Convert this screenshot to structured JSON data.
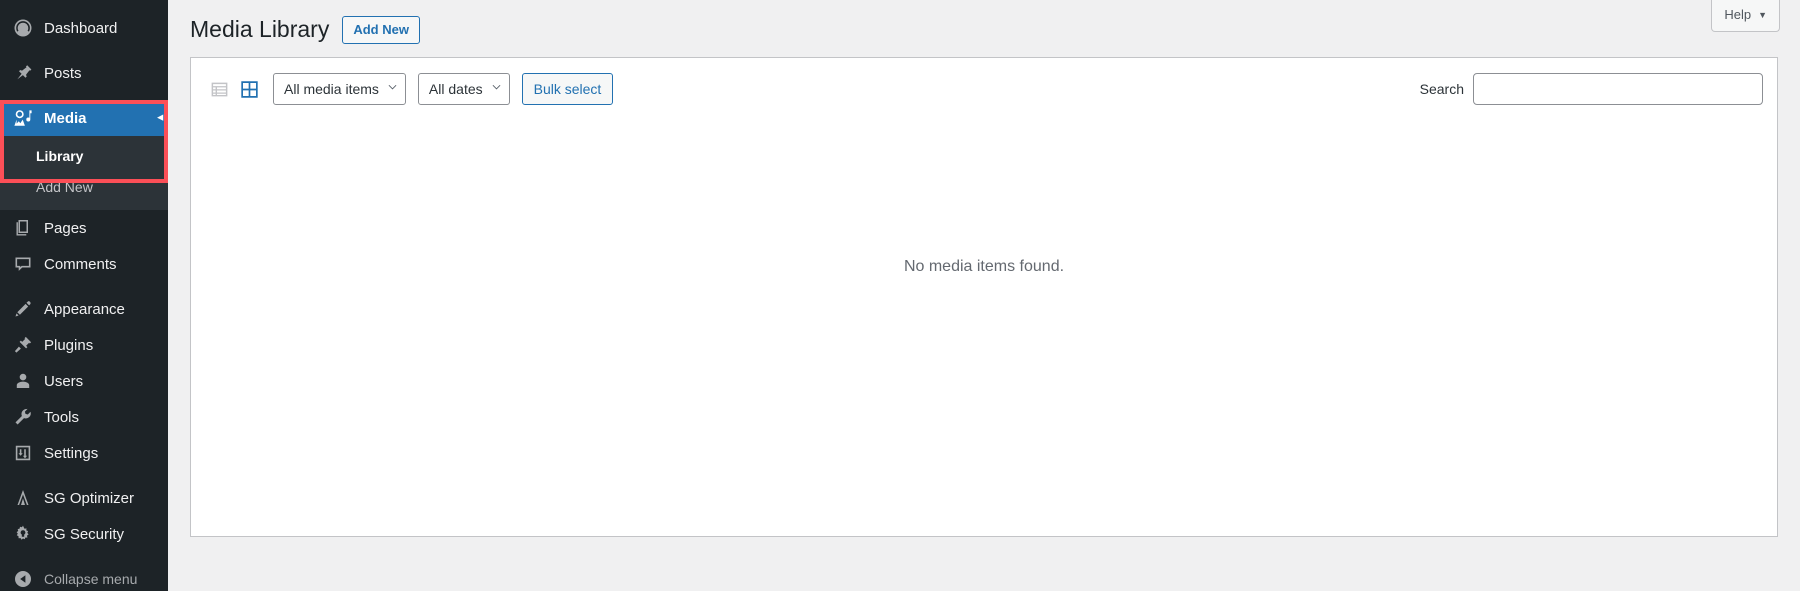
{
  "sidebar": {
    "items": [
      {
        "label": "Dashboard",
        "icon": "dashboard-icon",
        "name": "dashboard"
      },
      {
        "label": "Posts",
        "icon": "pin-icon",
        "name": "posts"
      },
      {
        "label": "Media",
        "icon": "media-icon",
        "name": "media",
        "current": true,
        "arrow": "◂"
      },
      {
        "label": "Pages",
        "icon": "pages-icon",
        "name": "pages"
      },
      {
        "label": "Comments",
        "icon": "comments-icon",
        "name": "comments"
      },
      {
        "label": "Appearance",
        "icon": "brush-icon",
        "name": "appearance"
      },
      {
        "label": "Plugins",
        "icon": "plugin-icon",
        "name": "plugins"
      },
      {
        "label": "Users",
        "icon": "user-icon",
        "name": "users"
      },
      {
        "label": "Tools",
        "icon": "wrench-icon",
        "name": "tools"
      },
      {
        "label": "Settings",
        "icon": "settings-icon",
        "name": "settings"
      },
      {
        "label": "SG Optimizer",
        "icon": "sg-optimizer-icon",
        "name": "sg-optimizer"
      },
      {
        "label": "SG Security",
        "icon": "sg-security-icon",
        "name": "sg-security"
      }
    ],
    "media_submenu": [
      {
        "label": "Library",
        "current": true
      },
      {
        "label": "Add New",
        "current": false
      }
    ],
    "collapse": {
      "label": "Collapse menu",
      "icon": "collapse-left-icon"
    }
  },
  "screen_meta": {
    "help_label": "Help",
    "help_caret": "▼"
  },
  "page": {
    "title": "Media Library",
    "add_new_label": "Add New"
  },
  "toolbar": {
    "view_list_icon": "list-view-icon",
    "view_grid_icon": "grid-view-icon",
    "filter_type": "All media items",
    "filter_date": "All dates",
    "bulk_select_label": "Bulk select",
    "search_label": "Search",
    "search_value": "",
    "search_placeholder": ""
  },
  "content": {
    "empty_message": "No media items found."
  },
  "colors": {
    "sidebar_bg": "#1d2327",
    "submenu_bg": "#2c3338",
    "accent_blue": "#2271b1",
    "annotation_red": "#fc4f57",
    "page_bg": "#f0f0f1"
  }
}
